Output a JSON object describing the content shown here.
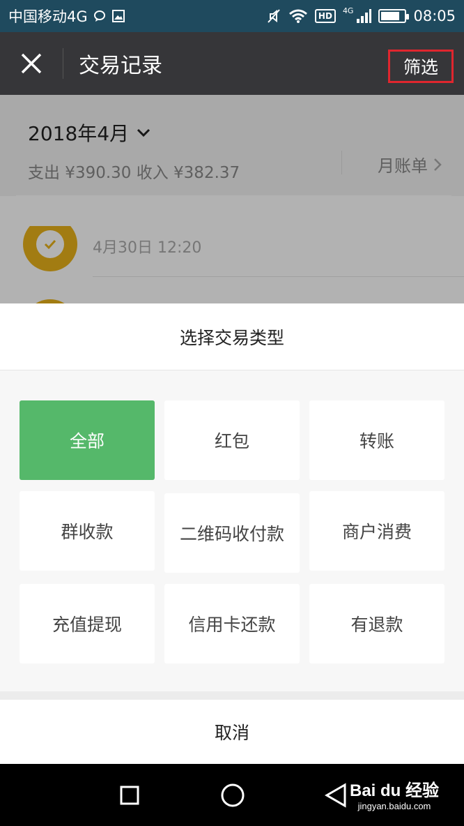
{
  "status_bar": {
    "carrier": "中国移动4G",
    "hd": "HD",
    "network": "4G",
    "time": "08:05",
    "battery_level": 0.8
  },
  "title_bar": {
    "title": "交易记录",
    "filter_label": "筛选"
  },
  "content": {
    "month": "2018年4月",
    "summary": "支出 ¥390.30 收入 ¥382.37",
    "monthly_bill": "月账单",
    "transactions": [
      {
        "time": "4月30日 12:20"
      }
    ]
  },
  "sheet": {
    "title": "选择交易类型",
    "options": [
      "全部",
      "红包",
      "转账",
      "群收款",
      "二维码收付款",
      "商户消费",
      "充值提现",
      "信用卡还款",
      "有退款"
    ],
    "selected_option": "全部",
    "cancel_label": "取消"
  },
  "watermark": {
    "logo": "Bai du 经验",
    "url": "jingyan.baidu.com"
  },
  "colors": {
    "status_bar": "#1f4a5e",
    "title_bar": "#363639",
    "filter_highlight": "#e0262e",
    "selected_green": "#55b86a",
    "avatar_gold": "#e8b21a"
  }
}
